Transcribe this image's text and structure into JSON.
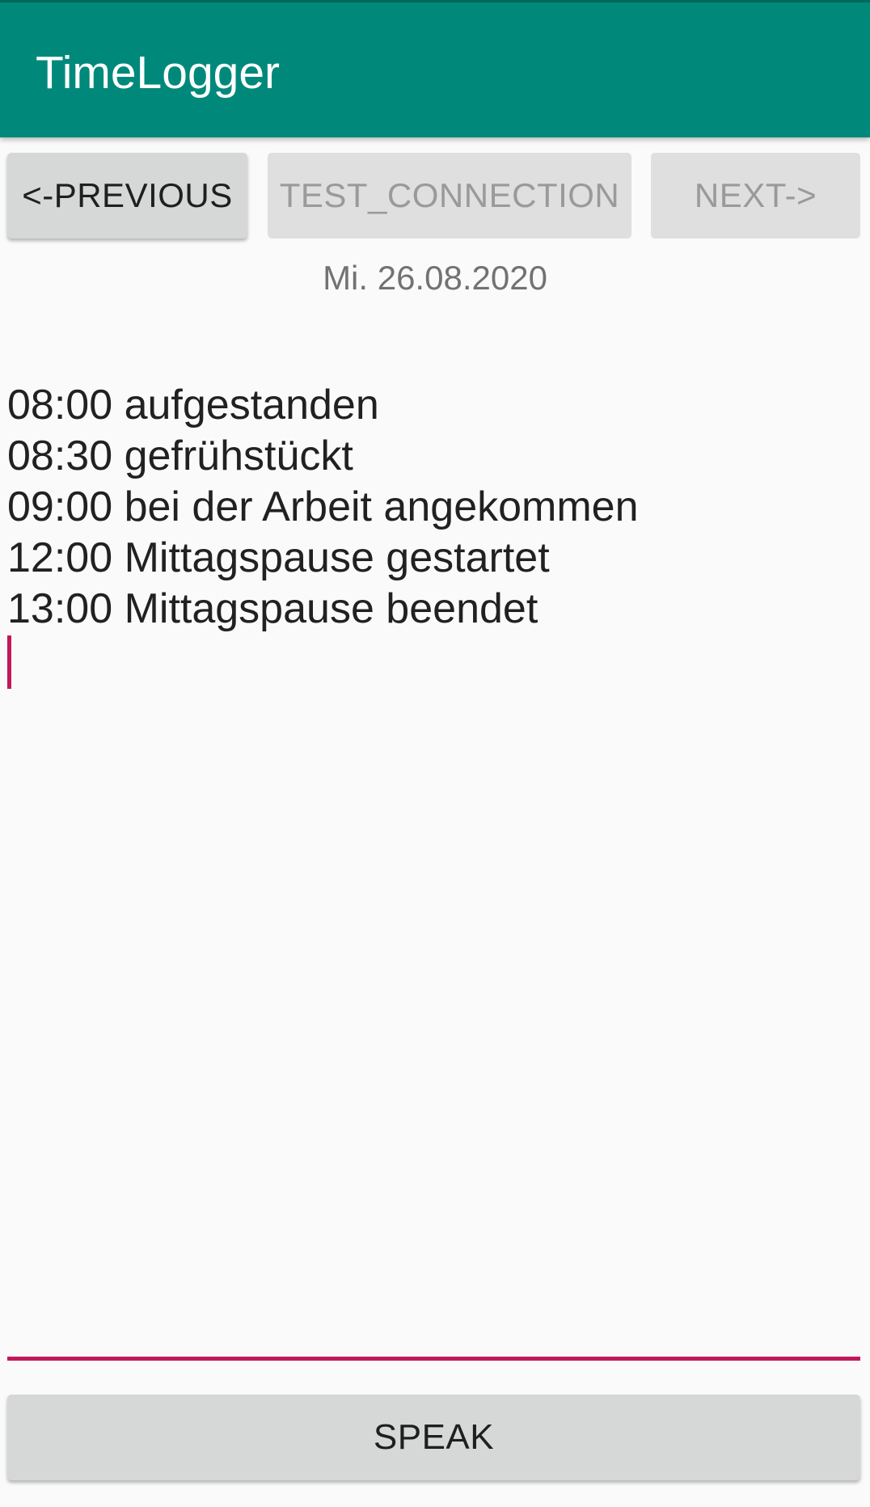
{
  "app_bar": {
    "title": "TimeLogger",
    "color": "#00897b"
  },
  "toolbar": {
    "previous_label": "<-PREVIOUS",
    "previous_enabled": true,
    "test_connection_label": "TEST_CONNECTION",
    "test_connection_enabled": false,
    "next_label": "NEXT->",
    "next_enabled": false
  },
  "date": "Mi. 26.08.2020",
  "log_entries": [
    "08:00 aufgestanden",
    "08:30 gefrühstückt",
    "09:00 bei der Arbeit angekommen",
    "12:00 Mittagspause gestartet",
    "13:00 Mittagspause beendet"
  ],
  "editor": {
    "accent_color": "#c2185b"
  },
  "speak_label": "SPEAK"
}
